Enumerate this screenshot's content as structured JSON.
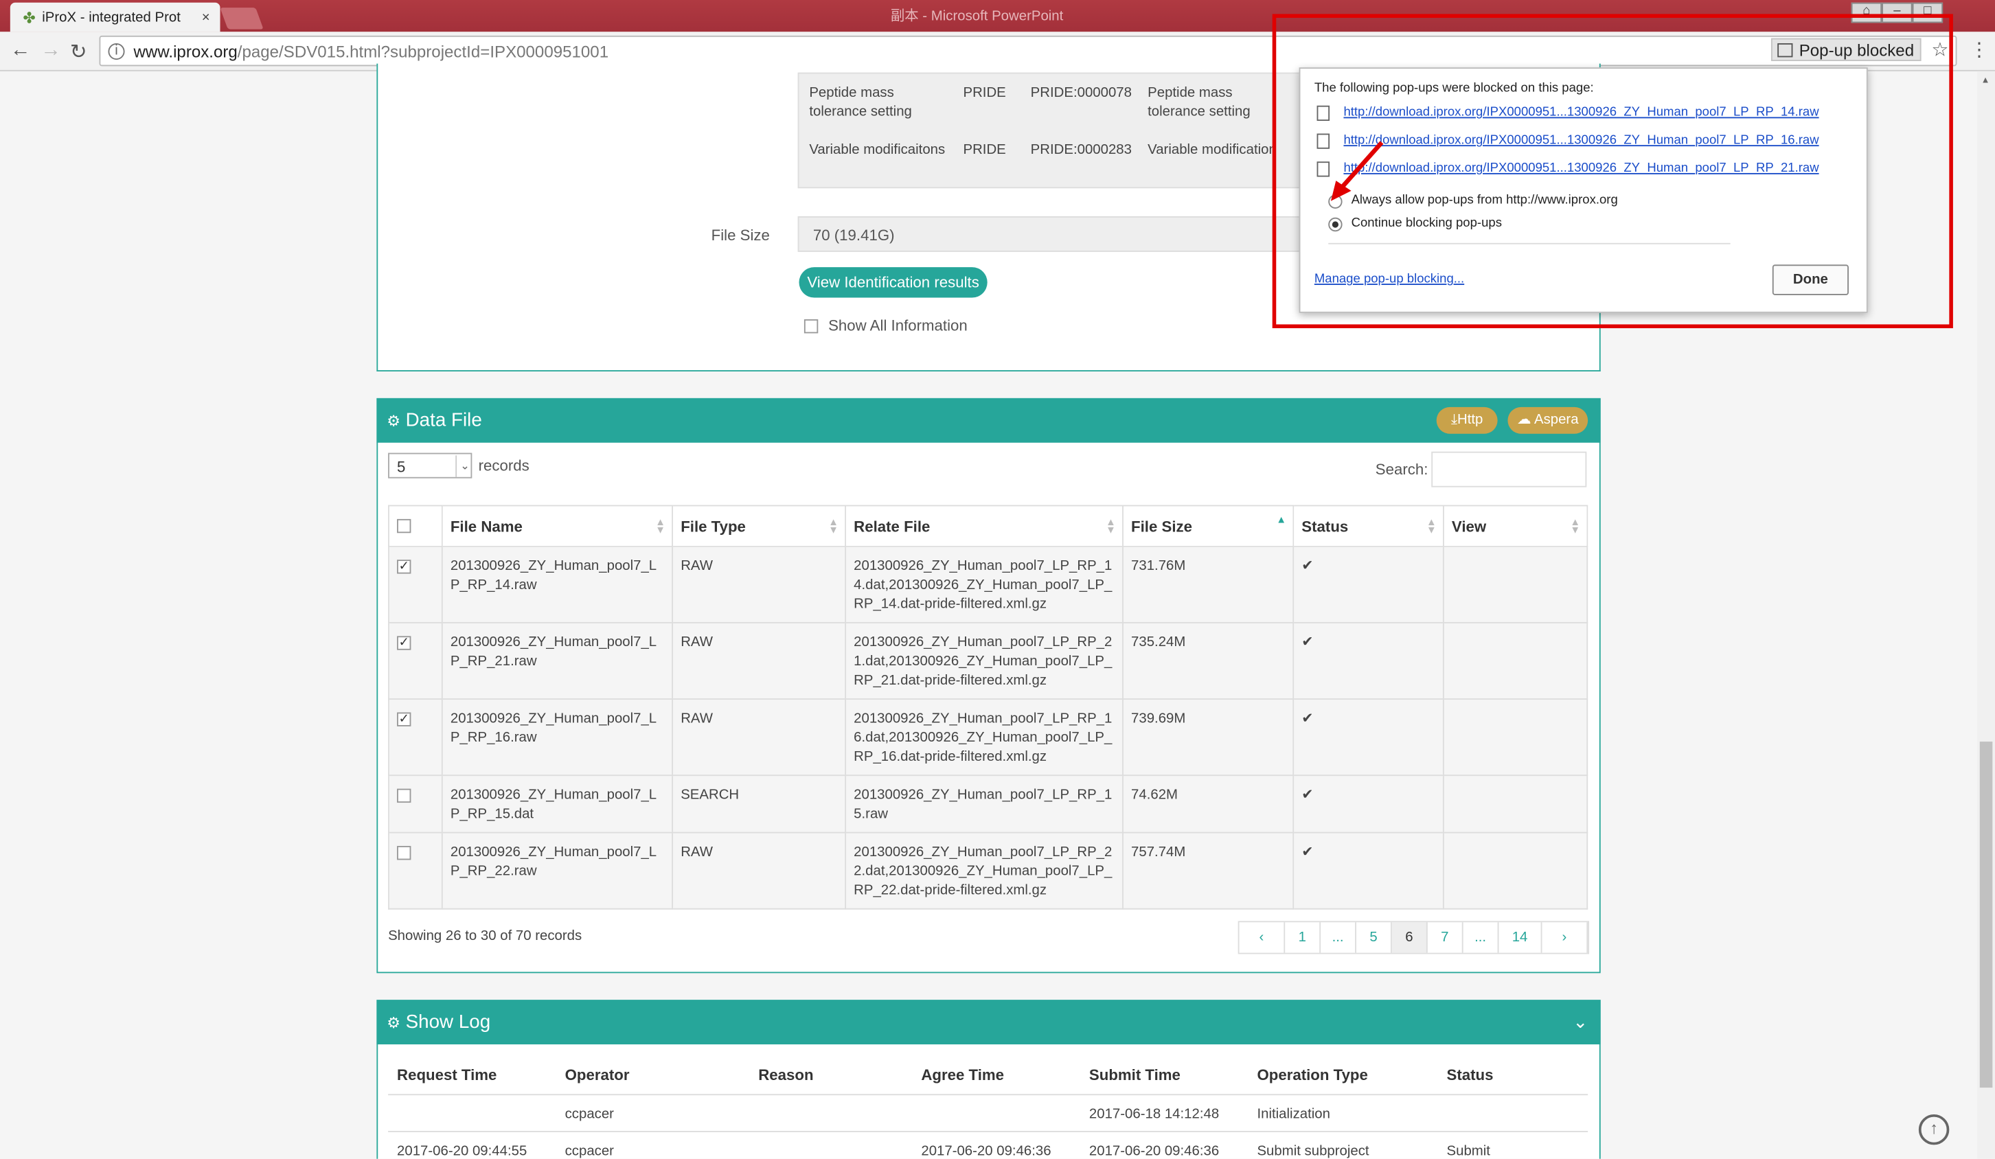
{
  "browser": {
    "tab_title": "iProX - integrated Prot",
    "tab_close": "×",
    "url_host": "www.iprox.org",
    "url_path": "/page/SDV015.html?subprojectId=IPX0000951001",
    "popup_chip": "Pop-up blocked",
    "bg_title": "副本 - Microsoft PowerPoint"
  },
  "identification": {
    "rows": [
      {
        "name": "Peptide mass tolerance setting",
        "db": "PRIDE",
        "acc": "PRIDE:0000078",
        "value": "Peptide mass tolerance setting"
      },
      {
        "name": "Variable modificaitons",
        "db": "PRIDE",
        "acc": "PRIDE:0000283",
        "value": "Variable modification"
      }
    ],
    "file_size_label": "File Size",
    "file_size_value": "70 (19.41G)",
    "view_button": "View Identification results",
    "show_all_label": "Show All Information"
  },
  "data_file": {
    "title": "Data File",
    "http_button": "Http",
    "aspera_button": "Aspera",
    "records_value": "5",
    "records_label": "records",
    "search_label": "Search:",
    "search_value": "",
    "columns": [
      "File Name",
      "File Type",
      "Relate File",
      "File Size",
      "Status",
      "View"
    ],
    "rows": [
      {
        "checked": true,
        "name": [
          "201300926_ZY_Human_pool7_L",
          "P_RP_14.raw"
        ],
        "type": "RAW",
        "relate": [
          "201300926_ZY_Human_pool7_LP_RP_1",
          "4.dat,201300926_ZY_Human_pool7_LP_",
          "RP_14.dat-pride-filtered.xml.gz"
        ],
        "size": "731.76M",
        "status": "✔"
      },
      {
        "checked": true,
        "name": [
          "201300926_ZY_Human_pool7_L",
          "P_RP_21.raw"
        ],
        "type": "RAW",
        "relate": [
          "201300926_ZY_Human_pool7_LP_RP_2",
          "1.dat,201300926_ZY_Human_pool7_LP_",
          "RP_21.dat-pride-filtered.xml.gz"
        ],
        "size": "735.24M",
        "status": "✔"
      },
      {
        "checked": true,
        "name": [
          "201300926_ZY_Human_pool7_L",
          "P_RP_16.raw"
        ],
        "type": "RAW",
        "relate": [
          "201300926_ZY_Human_pool7_LP_RP_1",
          "6.dat,201300926_ZY_Human_pool7_LP_",
          "RP_16.dat-pride-filtered.xml.gz"
        ],
        "size": "739.69M",
        "status": "✔"
      },
      {
        "checked": false,
        "name": [
          "201300926_ZY_Human_pool7_L",
          "P_RP_15.dat"
        ],
        "type": "SEARCH",
        "relate": [
          "201300926_ZY_Human_pool7_LP_RP_1",
          "5.raw"
        ],
        "size": "74.62M",
        "status": "✔"
      },
      {
        "checked": false,
        "name": [
          "201300926_ZY_Human_pool7_L",
          "P_RP_22.raw"
        ],
        "type": "RAW",
        "relate": [
          "201300926_ZY_Human_pool7_LP_RP_2",
          "2.dat,201300926_ZY_Human_pool7_LP_",
          "RP_22.dat-pride-filtered.xml.gz"
        ],
        "size": "757.74M",
        "status": "✔"
      }
    ],
    "showing": "Showing 26 to 30 of 70 records",
    "pages": [
      "‹",
      "1",
      "...",
      "5",
      "6",
      "7",
      "...",
      "14",
      "›"
    ],
    "active_page": "6"
  },
  "show_log": {
    "title": "Show Log",
    "columns": [
      "Request Time",
      "Operator",
      "Reason",
      "Agree Time",
      "Submit Time",
      "Operation Type",
      "Status"
    ],
    "rows": [
      [
        "",
        "ccpacer",
        "",
        "",
        "2017-06-18 14:12:48",
        "Initialization",
        ""
      ],
      [
        "2017-06-20 09:44:55",
        "ccpacer",
        "",
        "2017-06-20 09:46:36",
        "2017-06-20 09:46:36",
        "Submit subproject",
        "Submit"
      ]
    ]
  },
  "popup": {
    "heading": "The following pop-ups were blocked on this page:",
    "links": [
      "http://download.iprox.org/IPX0000951...1300926_ZY_Human_pool7_LP_RP_14.raw",
      "http://download.iprox.org/IPX0000951...1300926_ZY_Human_pool7_LP_RP_16.raw",
      "http://download.iprox.org/IPX0000951...1300926_ZY_Human_pool7_LP_RP_21.raw"
    ],
    "option_allow": "Always allow pop-ups from http://www.iprox.org",
    "option_block": "Continue blocking pop-ups",
    "manage_link": "Manage pop-up blocking...",
    "done_button": "Done"
  },
  "colors": {
    "accent": "#26a69a",
    "gold": "#c9a24a",
    "highlight": "#e00000",
    "link": "#1a4dc9"
  }
}
